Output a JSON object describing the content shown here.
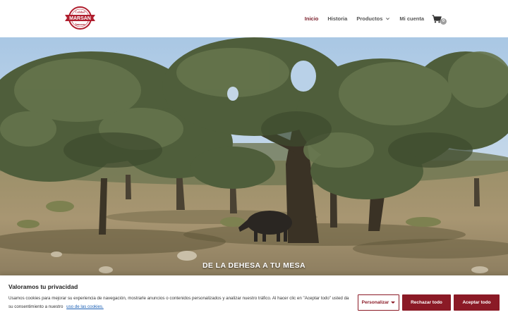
{
  "header": {
    "logo": {
      "top_text": "Calidad",
      "brand": "MARSAN",
      "bottom_text": "Jamones",
      "color": "#b01e2e"
    },
    "nav": [
      {
        "label": "Inicio",
        "active": true
      },
      {
        "label": "Historia",
        "active": false
      },
      {
        "label": "Productos",
        "active": false,
        "has_dropdown": true
      },
      {
        "label": "Mi cuenta",
        "active": false
      }
    ],
    "cart": {
      "icon": "cart-icon",
      "count": "0"
    }
  },
  "hero": {
    "caption": "DE LA DEHESA A TU MESA"
  },
  "cookie": {
    "title": "Valoramos tu privacidad",
    "text": "Usamos cookies para mejorar su experiencia de navegación, mostrarle anuncios o contenidos personalizados y analizar nuestro tráfico. Al hacer clic en \"Aceptar todo\" usted da su consentimiento a nuestro",
    "link": "uso de las cookies.",
    "buttons": {
      "customize": "Personalizar",
      "reject": "Rechazar todo",
      "accept": "Aceptar todo"
    }
  },
  "colors": {
    "brand": "#8b1a26",
    "nav_active": "#7a1f2b",
    "link": "#1a5fb4"
  }
}
